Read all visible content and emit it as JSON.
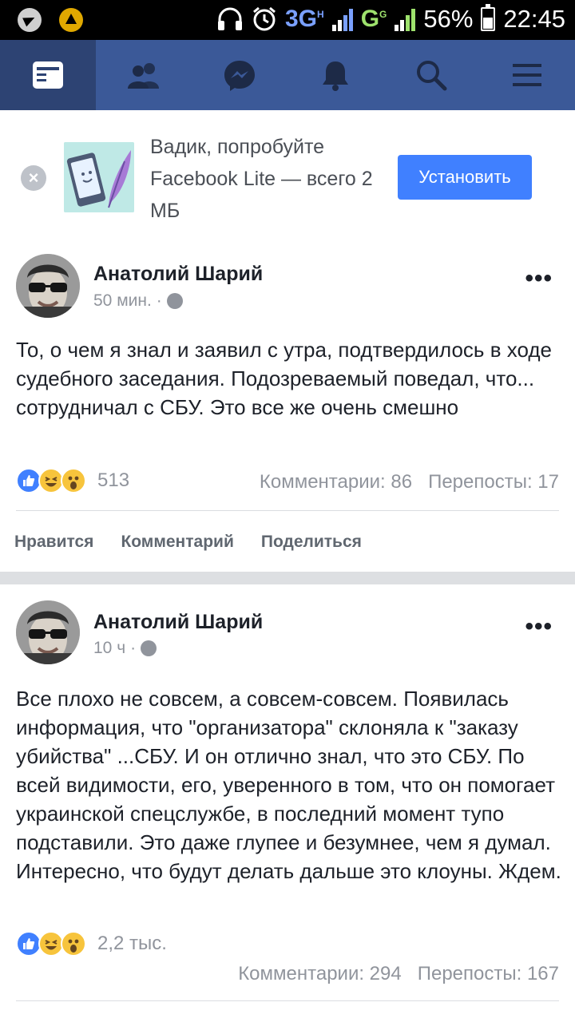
{
  "status_bar": {
    "network_1": "3G",
    "network_1_sup": "H",
    "network_2": "G",
    "network_2_sup": "G",
    "battery": "56%",
    "time": "22:45"
  },
  "nav": {
    "tabs": [
      {
        "icon": "news-feed-icon",
        "active": true
      },
      {
        "icon": "friends-icon",
        "active": false
      },
      {
        "icon": "messenger-icon",
        "active": false
      },
      {
        "icon": "notifications-bell-icon",
        "active": false
      },
      {
        "icon": "search-icon",
        "active": false
      },
      {
        "icon": "menu-icon",
        "active": false
      }
    ]
  },
  "promo": {
    "text": "Вадик, попробуйте Facebook Lite — всего 2 МБ",
    "install_label": "Установить",
    "dismiss_symbol": "×"
  },
  "posts": [
    {
      "author": "Анатолий Шарий",
      "time": "50 мин.",
      "text": "То, о чем я знал и заявил с утра, подтвердилось в ходе судебного заседания. Подозреваемый поведал, что... сотрудничал с СБУ. Это все же очень смешно",
      "reaction_count": "513",
      "comments": "Комментарии: 86",
      "shares": "Перепосты: 17"
    },
    {
      "author": "Анатолий Шарий",
      "time": "10 ч",
      "text": "Все плохо не совсем, а совсем-совсем. Появилась информация, что \"организатора\" склоняла к \"заказу убийства\" ...СБУ. И он отлично знал, что это СБУ. По всей видимости, его, уверенного в том, что он помогает украинской спецслужбе, в последний момент тупо подставили. Это даже глупее и безумнее, чем я думал. Интересно, что будут делать дальше это клоуны. Ждем.",
      "reaction_count": "2,2 тыс.",
      "comments": "Комментарии: 294",
      "shares": "Перепосты: 167"
    }
  ],
  "actions": {
    "like": "Нравится",
    "comment": "Комментарий",
    "share": "Поделиться"
  },
  "more_symbol": "•••",
  "meta_separator": "·",
  "colors": {
    "fb_blue": "#3b5998",
    "fb_blue_active": "#2d4373",
    "install_blue": "#4080ff",
    "muted_text": "#90949c"
  }
}
